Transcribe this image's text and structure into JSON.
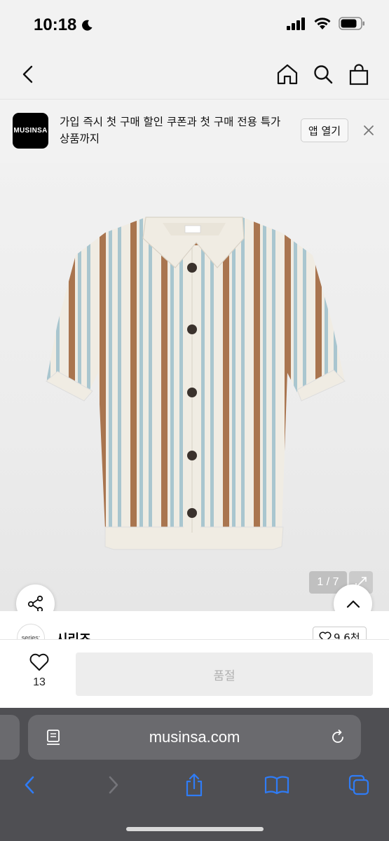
{
  "status": {
    "time": "10:18"
  },
  "nav": {
    "back_icon": "chevron-left-icon",
    "home_icon": "home-icon",
    "search_icon": "search-icon",
    "cart_icon": "shopping-bag-icon"
  },
  "banner": {
    "logo_text": "MUSINSA",
    "message": "가입 즉시 첫 구매 할인 쿠폰과 첫 구매 전용 특가 상품까지",
    "open_label": "앱 열기"
  },
  "product": {
    "image_index": "1 / 7",
    "shirt_colors": {
      "base": "#f0ece3",
      "stripe_brown": "#a9754f",
      "stripe_blue": "#a9c6cf",
      "button": "#3a322d"
    }
  },
  "brand": {
    "logo_text": "series:",
    "name": "시리즈",
    "likes": "9.6천"
  },
  "purchase": {
    "like_count": "13",
    "soldout_label": "품절"
  },
  "safari": {
    "url": "musinsa.com",
    "accent": "#2f7cf6"
  }
}
